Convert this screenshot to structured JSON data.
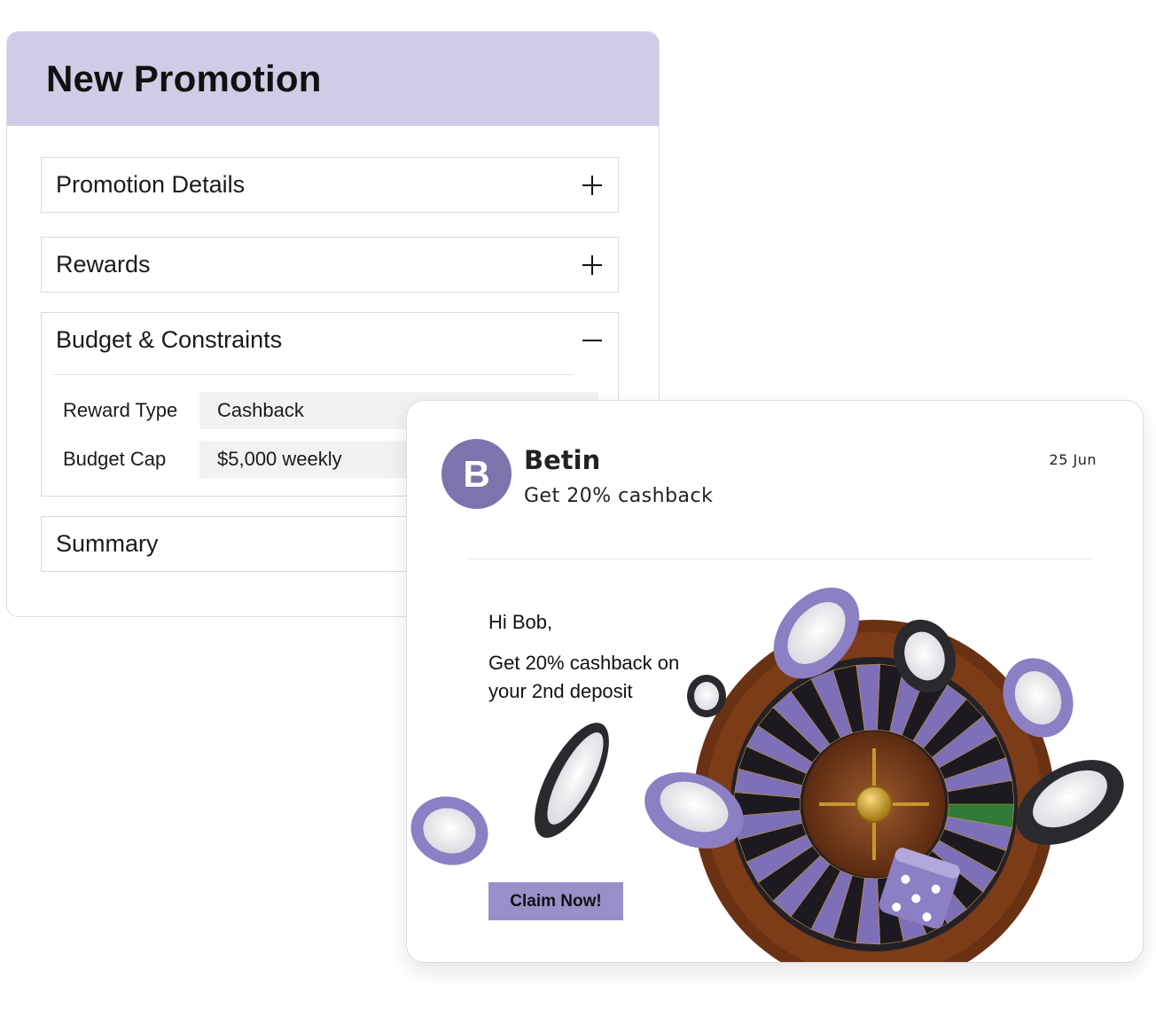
{
  "promotion_form": {
    "title": "New Promotion",
    "sections": [
      {
        "label": "Promotion Details",
        "state": "collapsed",
        "icon": "plus-icon"
      },
      {
        "label": "Rewards",
        "state": "collapsed",
        "icon": "plus-icon"
      },
      {
        "label": "Budget & Constraints",
        "state": "expanded",
        "icon": "minus-icon"
      },
      {
        "label": "Summary",
        "state": "collapsed",
        "icon": "plus-icon"
      }
    ],
    "budget_fields": [
      {
        "label": "Reward Type",
        "value": "Cashback"
      },
      {
        "label": "Budget Cap",
        "value": "$5,000 weekly"
      }
    ]
  },
  "notification": {
    "avatar_letter": "B",
    "sender": "Betin",
    "subject": "Get 20% cashback",
    "date": "25 Jun",
    "greeting": "Hi Bob,",
    "message": "Get 20% cashback on your 2nd deposit",
    "cta_label": "Claim Now!",
    "artwork": "roulette-wheel-chips-dice",
    "colors": {
      "accent": "#9990c9",
      "avatar": "#7c74ad",
      "header": "#cfcce6"
    }
  }
}
